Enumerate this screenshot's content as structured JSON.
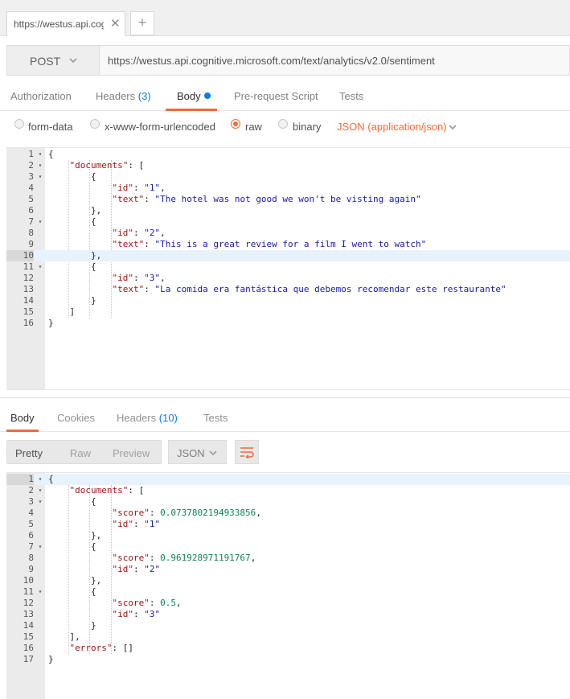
{
  "tabbar": {
    "tab_label": "https://westus.api.cog",
    "close_glyph": "✕",
    "add_glyph": "+"
  },
  "request": {
    "method": "POST",
    "url": "https://westus.api.cognitive.microsoft.com/text/analytics/v2.0/sentiment"
  },
  "request_tabs": {
    "authorization": "Authorization",
    "headers": "Headers",
    "headers_count": "(3)",
    "body": "Body",
    "prerequest": "Pre-request Script",
    "tests": "Tests"
  },
  "body_types": {
    "form_data": "form-data",
    "urlencoded": "x-www-form-urlencoded",
    "raw": "raw",
    "binary": "binary",
    "selected": "raw",
    "content_type": "JSON (application/json)"
  },
  "request_editor": {
    "active_line": 10,
    "lines": [
      {
        "n": "1",
        "fold": "▾",
        "code": "{"
      },
      {
        "n": "2",
        "fold": "▾",
        "code": "    \"documents\": ["
      },
      {
        "n": "3",
        "fold": "▾",
        "code": "        {"
      },
      {
        "n": "4",
        "fold": "",
        "code": "            \"id\": \"1\","
      },
      {
        "n": "5",
        "fold": "",
        "code": "            \"text\": \"The hotel was not good we won't be visting again\""
      },
      {
        "n": "6",
        "fold": "",
        "code": "        },"
      },
      {
        "n": "7",
        "fold": "▾",
        "code": "        {"
      },
      {
        "n": "8",
        "fold": "",
        "code": "            \"id\": \"2\","
      },
      {
        "n": "9",
        "fold": "",
        "code": "            \"text\": \"This is a great review for a film I went to watch\""
      },
      {
        "n": "10",
        "fold": "",
        "code": "        },"
      },
      {
        "n": "11",
        "fold": "▾",
        "code": "        {"
      },
      {
        "n": "12",
        "fold": "",
        "code": "            \"id\": \"3\","
      },
      {
        "n": "13",
        "fold": "",
        "code": "            \"text\": \"La comida era fantástica que debemos recomendar este restaurante\""
      },
      {
        "n": "14",
        "fold": "",
        "code": "        }"
      },
      {
        "n": "15",
        "fold": "",
        "code": "    ]"
      },
      {
        "n": "16",
        "fold": "",
        "code": "}"
      }
    ]
  },
  "response_tabs": {
    "body": "Body",
    "cookies": "Cookies",
    "headers": "Headers",
    "headers_count": "(10)",
    "tests": "Tests"
  },
  "response_view": {
    "pretty": "Pretty",
    "raw": "Raw",
    "preview": "Preview",
    "language": "JSON",
    "wrap_icon": "wrap-lines-icon"
  },
  "response_editor": {
    "active_line": 1,
    "lines": [
      {
        "n": "1",
        "fold": "▾",
        "code": "{"
      },
      {
        "n": "2",
        "fold": "▾",
        "code": "    \"documents\": ["
      },
      {
        "n": "3",
        "fold": "▾",
        "code": "        {"
      },
      {
        "n": "4",
        "fold": "",
        "code": "            \"score\": 0.0737802194933856,"
      },
      {
        "n": "5",
        "fold": "",
        "code": "            \"id\": \"1\""
      },
      {
        "n": "6",
        "fold": "",
        "code": "        },"
      },
      {
        "n": "7",
        "fold": "▾",
        "code": "        {"
      },
      {
        "n": "8",
        "fold": "",
        "code": "            \"score\": 0.961928971191767,"
      },
      {
        "n": "9",
        "fold": "",
        "code": "            \"id\": \"2\""
      },
      {
        "n": "10",
        "fold": "",
        "code": "        },"
      },
      {
        "n": "11",
        "fold": "▾",
        "code": "        {"
      },
      {
        "n": "12",
        "fold": "",
        "code": "            \"score\": 0.5,"
      },
      {
        "n": "13",
        "fold": "",
        "code": "            \"id\": \"3\""
      },
      {
        "n": "14",
        "fold": "",
        "code": "        }"
      },
      {
        "n": "15",
        "fold": "",
        "code": "    ],"
      },
      {
        "n": "16",
        "fold": "",
        "code": "    \"errors\": []"
      },
      {
        "n": "17",
        "fold": "",
        "code": "}"
      }
    ]
  },
  "colors": {
    "accent": "#f26b3a",
    "link_blue": "#097bed",
    "active_line": "#e8f2fc"
  }
}
